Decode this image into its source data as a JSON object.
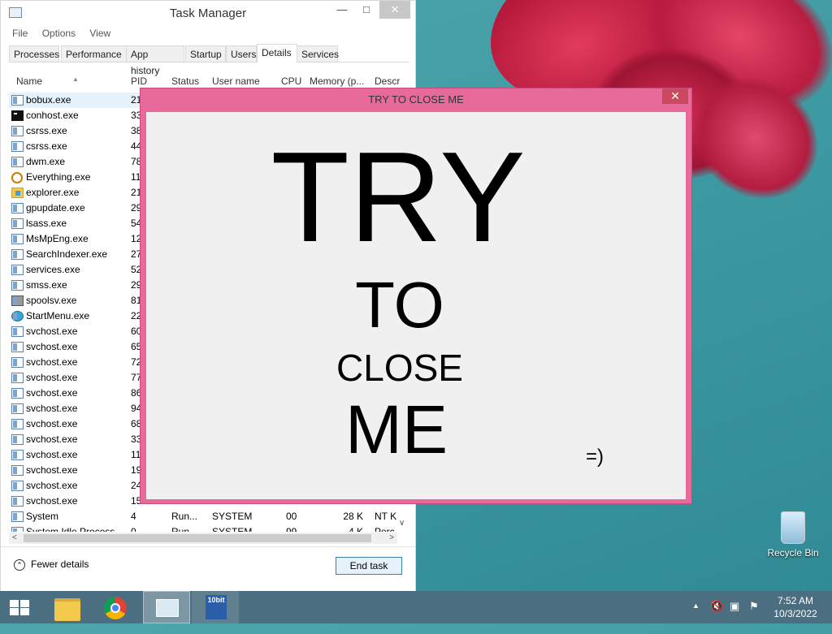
{
  "task_manager": {
    "title": "Task Manager",
    "menu": [
      "File",
      "Options",
      "View"
    ],
    "tabs": [
      "Processes",
      "Performance",
      "App history",
      "Startup",
      "Users",
      "Details",
      "Services"
    ],
    "active_tab": "Details",
    "columns": [
      "Name",
      "PID",
      "Status",
      "User name",
      "CPU",
      "Memory (p...",
      "Descr"
    ],
    "rows": [
      {
        "name": "bobux.exe",
        "pid": "21",
        "icon": "exe-icon"
      },
      {
        "name": "conhost.exe",
        "pid": "33",
        "icon": "console-icon"
      },
      {
        "name": "csrss.exe",
        "pid": "38",
        "icon": "exe-icon"
      },
      {
        "name": "csrss.exe",
        "pid": "44",
        "icon": "exe-icon"
      },
      {
        "name": "dwm.exe",
        "pid": "78",
        "icon": "exe-icon"
      },
      {
        "name": "Everything.exe",
        "pid": "11",
        "icon": "magnifier-icon"
      },
      {
        "name": "explorer.exe",
        "pid": "21",
        "icon": "folder-icon"
      },
      {
        "name": "gpupdate.exe",
        "pid": "29",
        "icon": "exe-icon"
      },
      {
        "name": "lsass.exe",
        "pid": "54",
        "icon": "exe-icon"
      },
      {
        "name": "MsMpEng.exe",
        "pid": "12",
        "icon": "exe-icon"
      },
      {
        "name": "SearchIndexer.exe",
        "pid": "27",
        "icon": "person-icon"
      },
      {
        "name": "services.exe",
        "pid": "52",
        "icon": "exe-icon"
      },
      {
        "name": "smss.exe",
        "pid": "29",
        "icon": "exe-icon"
      },
      {
        "name": "spoolsv.exe",
        "pid": "81",
        "icon": "printer-icon"
      },
      {
        "name": "StartMenu.exe",
        "pid": "22",
        "icon": "globe-icon"
      },
      {
        "name": "svchost.exe",
        "pid": "60",
        "icon": "exe-icon"
      },
      {
        "name": "svchost.exe",
        "pid": "65",
        "icon": "exe-icon"
      },
      {
        "name": "svchost.exe",
        "pid": "72",
        "icon": "exe-icon"
      },
      {
        "name": "svchost.exe",
        "pid": "77",
        "icon": "exe-icon"
      },
      {
        "name": "svchost.exe",
        "pid": "86",
        "icon": "exe-icon"
      },
      {
        "name": "svchost.exe",
        "pid": "94",
        "icon": "exe-icon"
      },
      {
        "name": "svchost.exe",
        "pid": "68",
        "icon": "exe-icon"
      },
      {
        "name": "svchost.exe",
        "pid": "33",
        "icon": "exe-icon"
      },
      {
        "name": "svchost.exe",
        "pid": "11",
        "icon": "exe-icon"
      },
      {
        "name": "svchost.exe",
        "pid": "19",
        "icon": "exe-icon"
      },
      {
        "name": "svchost.exe",
        "pid": "24",
        "icon": "exe-icon"
      },
      {
        "name": "svchost.exe",
        "pid": "15",
        "icon": "exe-icon"
      },
      {
        "name": "System",
        "pid": "4",
        "status": "Run...",
        "user": "SYSTEM",
        "cpu": "00",
        "memory": "28 K",
        "desc": "NT K",
        "icon": "exe-icon"
      },
      {
        "name": "System Idle Process",
        "pid": "0",
        "status": "Run...",
        "user": "SYSTEM",
        "cpu": "99",
        "memory": "4 K",
        "desc": "Perc",
        "icon": "exe-icon"
      }
    ],
    "fewer_details": "Fewer details",
    "end_task": "End task"
  },
  "popup": {
    "title": "TRY TO CLOSE ME",
    "close_glyph": "✕",
    "line1": "TRY",
    "line2": "TO",
    "line3": "CLOSE",
    "line4": "ME",
    "smiley": "=)"
  },
  "desktop": {
    "recycle_bin": "Recycle Bin"
  },
  "taskbar": {
    "time": "7:52 AM",
    "date": "10/3/2022",
    "tenbit_label": "10bit"
  },
  "colors": {
    "popup_border": "#e86a9a",
    "taskbar": "#4b6e80",
    "selection": "#e5f1fb"
  }
}
